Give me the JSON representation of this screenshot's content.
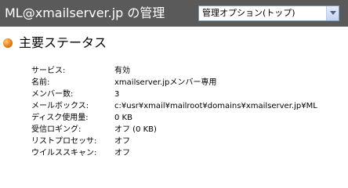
{
  "header": {
    "title": "ML@xmailserver.jp の管理",
    "option_select": {
      "value": "管理オプション(トップ)"
    }
  },
  "section": {
    "heading": "主要ステータス",
    "icon": "orange-bullet-icon"
  },
  "status_rows": [
    {
      "label": "サービス:",
      "value": "有効"
    },
    {
      "label": "名前:",
      "value": "xmailserver.jpメンバー専用"
    },
    {
      "label": "メンバー数:",
      "value": "3"
    },
    {
      "label": "メールボックス:",
      "value": "c:¥usr¥xmail¥mailroot¥domains¥xmailserver.jp¥ML"
    },
    {
      "label": "ディスク使用量:",
      "value": "0 KB"
    },
    {
      "label": "受信ロギング:",
      "value": "オフ (0 KB)"
    },
    {
      "label": "リストプロセッサ:",
      "value": "オフ"
    },
    {
      "label": "ウイルススキャン:",
      "value": "オフ"
    }
  ],
  "colors": {
    "header_bg": "#5a5a5a",
    "header_text": "#ffffff",
    "bullet": "#f08a1c"
  }
}
